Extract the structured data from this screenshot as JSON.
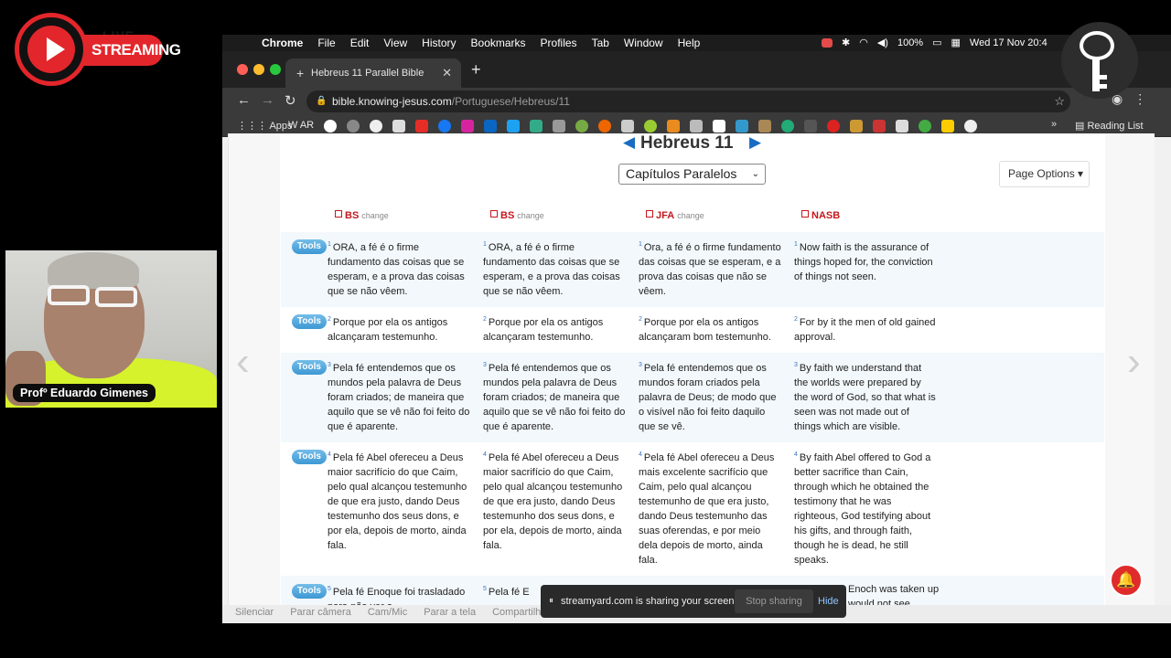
{
  "stream_logo": {
    "small_text": "LIVE",
    "pill_text": "STREAMING"
  },
  "webcam": {
    "name": "Profº Eduardo Gimenes"
  },
  "menubar": {
    "items": [
      "Chrome",
      "File",
      "Edit",
      "View",
      "History",
      "Bookmarks",
      "Profiles",
      "Tab",
      "Window",
      "Help"
    ],
    "battery": "100%",
    "datetime": "Wed 17 Nov 20:4"
  },
  "tab": {
    "title": "Hebreus 11 Parallel Bible",
    "favicon": "+"
  },
  "address": {
    "host": "bible.knowing-jesus.com",
    "path": "/Portuguese/Hebreus/11"
  },
  "bookmarks": {
    "apps": "Apps",
    "ar": "AR",
    "reading_list": "Reading List"
  },
  "page": {
    "chapter": "Hebreus 11",
    "select_value": "Capítulos Paralelos",
    "page_options": "Page Options",
    "versions": [
      {
        "name": "BS",
        "change": "change"
      },
      {
        "name": "BS",
        "change": "change"
      },
      {
        "name": "JFA",
        "change": "change"
      },
      {
        "name": "NASB",
        "change": ""
      }
    ],
    "tools_label": "Tools",
    "verses": [
      {
        "num": "1",
        "texts": [
          "ORA, a fé é o firme fundamento das coisas que se esperam, e a prova das coisas que se não vêem.",
          "ORA, a fé é o firme fundamento das coisas que se esperam, e a prova das coisas que se não vêem.",
          "Ora, a fé é o firme fundamento das coisas que se esperam, e a prova das coisas que não se vêem.",
          "Now faith is the assurance of things hoped for, the conviction of things not seen."
        ]
      },
      {
        "num": "2",
        "texts": [
          "Porque por ela os antigos alcançaram testemunho.",
          "Porque por ela os antigos alcançaram testemunho.",
          "Porque por ela os antigos alcançaram bom testemunho.",
          "For by it the men of old gained approval."
        ]
      },
      {
        "num": "3",
        "texts": [
          "Pela fé entendemos que os mundos pela palavra de Deus foram criados; de maneira que aquilo que se vê não foi feito do que é aparente.",
          "Pela fé entendemos que os mundos pela palavra de Deus foram criados; de maneira que aquilo que se vê não foi feito do que é aparente.",
          "Pela fé entendemos que os mundos foram criados pela palavra de Deus; de modo que o visível não foi feito daquilo que se vê.",
          "By faith we understand that the worlds were prepared by the word of God, so that what is seen was not made out of things which are visible."
        ]
      },
      {
        "num": "4",
        "texts": [
          "Pela fé Abel ofereceu a Deus maior sacrifício do que Caim, pelo qual alcançou testemunho de que era justo, dando Deus testemunho dos seus dons, e por ela, depois de morto, ainda fala.",
          "Pela fé Abel ofereceu a Deus maior sacrifício do que Caim, pelo qual alcançou testemunho de que era justo, dando Deus testemunho dos seus dons, e por ela, depois de morto, ainda fala.",
          "Pela fé Abel ofereceu a Deus mais excelente sacrifício que Caim, pelo qual alcançou testemunho de que era justo, dando Deus testemunho das suas oferendas, e por meio dela depois de morto, ainda fala.",
          "By faith Abel offered to God a better sacrifice than Cain, through which he obtained the testimony that he was righteous, God testifying about his gifts, and through faith, though he is dead, he still speaks."
        ]
      },
      {
        "num": "5",
        "texts": [
          "Pela fé Enoque foi trasladado para não ver a",
          "Pela fé E",
          "",
          "Enoch was taken up would not see"
        ]
      }
    ]
  },
  "bottom_bar": {
    "items": [
      "Silenciar",
      "Parar câmera",
      "Cam/Mic",
      "Parar a tela",
      "Compartilhar"
    ]
  },
  "share_banner": {
    "message": "streamyard.com is sharing your screen.",
    "stop": "Stop sharing",
    "hide": "Hide"
  },
  "colors": {
    "accent_red": "#e3262b",
    "version_red": "#c4171c",
    "tools_blue": "#3d98d4",
    "link_blue": "#1a6cc2"
  }
}
